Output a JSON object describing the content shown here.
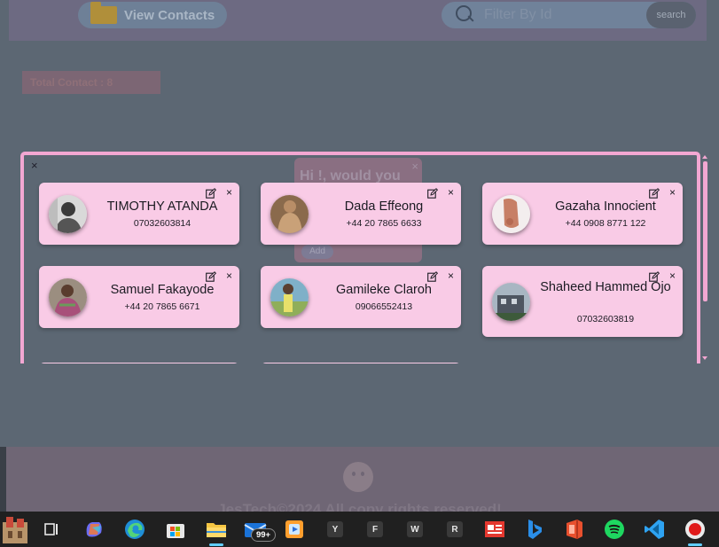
{
  "header": {
    "view_contacts_label": "View Contacts",
    "search_placeholder": "Filter By Id",
    "search_button_label": "search"
  },
  "total_contact_label": "Total Contact : 8",
  "greeting_card": {
    "text": "Hi !, would you",
    "close_label": "×",
    "add_label": "Add"
  },
  "modal": {
    "close_label": "×",
    "contacts": [
      {
        "name": "TIMOTHY ATANDA",
        "phone": "07032603814"
      },
      {
        "name": "Dada Effeong",
        "phone": "+44 20 7865 6633"
      },
      {
        "name": "Gazaha Innocient",
        "phone": "+44 0908 8771 122"
      },
      {
        "name": "Samuel Fakayode",
        "phone": "+44 20 7865 6671"
      },
      {
        "name": "Gamileke Claroh",
        "phone": "09066552413"
      },
      {
        "name": "Shaheed Hammed Ojo",
        "phone": "07032603819"
      }
    ],
    "delete_label": "×"
  },
  "footer": {
    "text": "JesTech©2024 All copy rights reserved!"
  },
  "taskbar": {
    "mail_badge": "99+",
    "letters": [
      "Y",
      "F",
      "W",
      "R"
    ]
  },
  "colors": {
    "card_bg": "#f9cbe6",
    "modal_border": "#f3a7d2",
    "taskbar_bg": "#202020"
  }
}
